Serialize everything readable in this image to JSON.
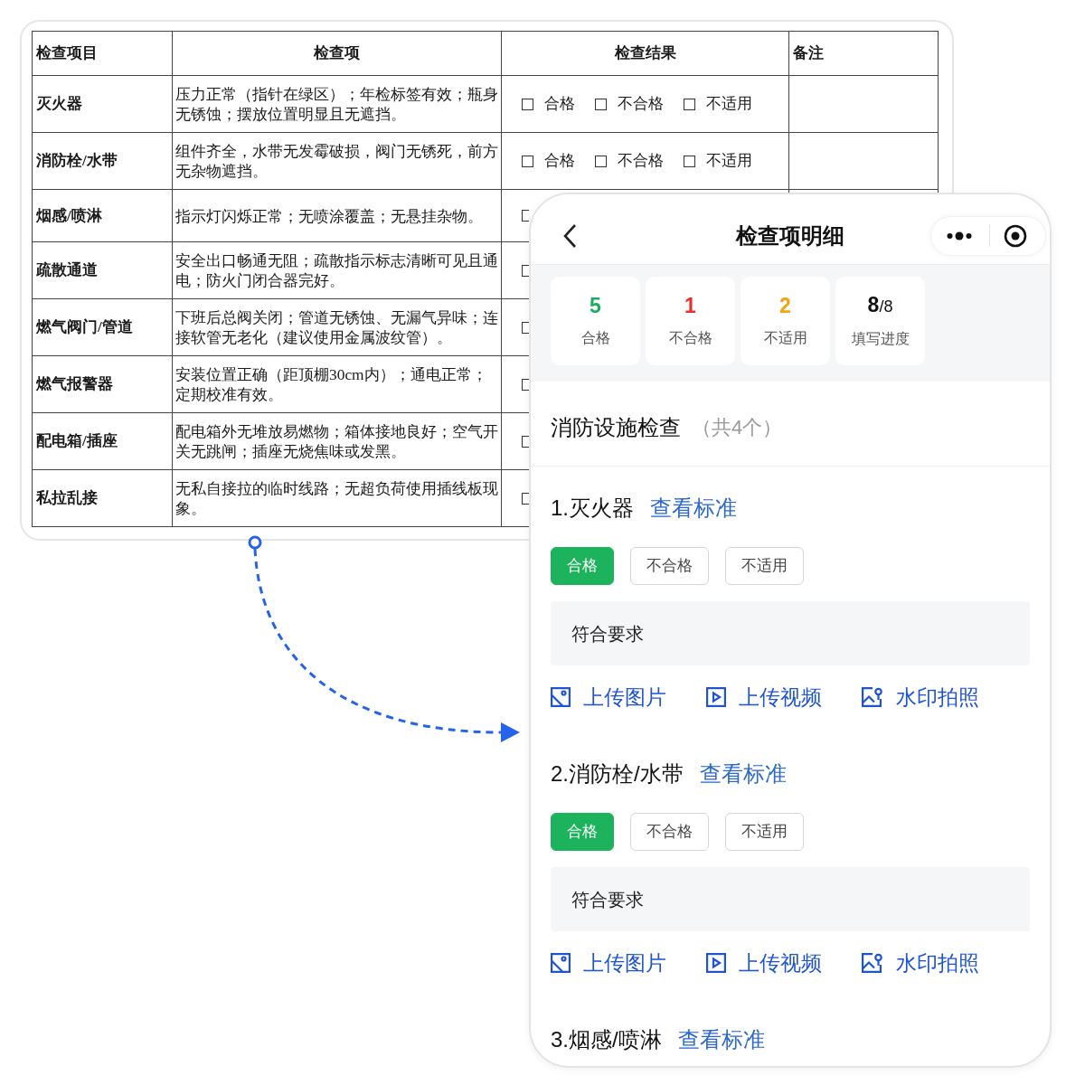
{
  "sheet": {
    "columns": [
      "检查项目",
      "检查项",
      "检查结果",
      "备注"
    ],
    "rows": [
      {
        "item": "灭火器",
        "criteria": "压力正常（指针在绿区）；年检标签有效；瓶身无锈蚀；摆放位置明显且无遮挡。",
        "results": [
          {
            "label": "合格",
            "checked": false
          },
          {
            "label": "不合格",
            "checked": false
          },
          {
            "label": "不适用",
            "checked": false
          }
        ]
      },
      {
        "item": "消防栓/水带",
        "criteria": "组件齐全，水带无发霉破损，阀门无锈死，前方无杂物遮挡。",
        "results": [
          {
            "label": "合格",
            "checked": false
          },
          {
            "label": "不合格",
            "checked": false
          },
          {
            "label": "不适用",
            "checked": false
          }
        ]
      },
      {
        "item": "烟感/喷淋",
        "criteria": "指示灯闪烁正常；无喷涂覆盖；无悬挂杂物。",
        "results": [
          {
            "checked": false
          }
        ]
      },
      {
        "item": "疏散通道",
        "criteria": "安全出口畅通无阻；疏散指示标志清晰可见且通电；防火门闭合器完好。",
        "results": [
          {
            "checked": false
          }
        ]
      },
      {
        "item": "燃气阀门/管道",
        "criteria": "下班后总阀关闭；管道无锈蚀、无漏气异味；连接软管无老化（建议使用金属波纹管）。",
        "results": [
          {
            "checked": false
          }
        ]
      },
      {
        "item": "燃气报警器",
        "criteria": "安装位置正确（距顶棚30cm内）；通电正常；定期校准有效。",
        "results": [
          {
            "checked": false
          }
        ]
      },
      {
        "item": "配电箱/插座",
        "criteria": "配电箱外无堆放易燃物；箱体接地良好；空气开关无跳闸；插座无烧焦味或发黑。",
        "results": [
          {
            "checked": false
          }
        ]
      },
      {
        "item": "私拉乱接",
        "criteria": "无私自接拉的临时线路；无超负荷使用插线板现象。",
        "results": [
          {
            "checked": false
          }
        ]
      }
    ]
  },
  "phone": {
    "title": "检查项明细",
    "stats": [
      {
        "value": "5",
        "label": "合格",
        "color": "#1aaf5d"
      },
      {
        "value": "1",
        "label": "不合格",
        "color": "#e5322d"
      },
      {
        "value": "2",
        "label": "不适用",
        "color": "#f4a40c"
      },
      {
        "value": "8",
        "suffix": "/8",
        "label": "填写进度",
        "color": "#111111"
      }
    ],
    "section": {
      "title": "消防设施检查",
      "count": "（共4个）"
    },
    "items": [
      {
        "title": "1.灭火器",
        "link": "查看标准",
        "options": [
          {
            "label": "合格",
            "selected": true
          },
          {
            "label": "不合格",
            "selected": false
          },
          {
            "label": "不适用",
            "selected": false
          }
        ],
        "remark": "符合要求",
        "uploads": [
          {
            "kind": "image",
            "label": "上传图片"
          },
          {
            "kind": "video",
            "label": "上传视频"
          },
          {
            "kind": "watermark",
            "label": "水印拍照"
          }
        ]
      },
      {
        "title": "2.消防栓/水带",
        "link": "查看标准",
        "options": [
          {
            "label": "合格",
            "selected": true
          },
          {
            "label": "不合格",
            "selected": false
          },
          {
            "label": "不适用",
            "selected": false
          }
        ],
        "remark": "符合要求",
        "uploads": [
          {
            "kind": "image",
            "label": "上传图片"
          },
          {
            "kind": "video",
            "label": "上传视频"
          },
          {
            "kind": "watermark",
            "label": "水印拍照"
          }
        ]
      },
      {
        "title": "3.烟感/喷淋",
        "link": "查看标准"
      }
    ]
  }
}
